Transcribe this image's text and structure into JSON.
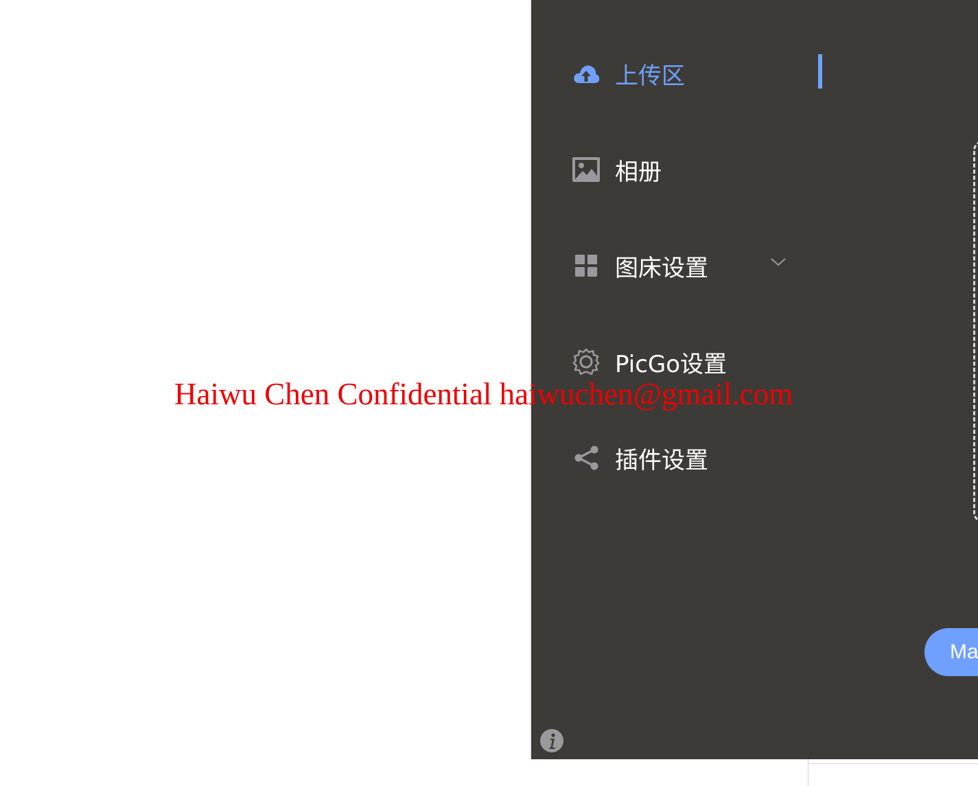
{
  "sidebar": {
    "items": [
      {
        "label": "上传区",
        "icon": "cloud-upload-icon",
        "active": true
      },
      {
        "label": "相册",
        "icon": "image-icon",
        "active": false
      },
      {
        "label": "图床设置",
        "icon": "grid-icon",
        "active": false,
        "expandable": true
      },
      {
        "label": "PicGo设置",
        "icon": "gear-icon",
        "active": false
      },
      {
        "label": "插件设置",
        "icon": "share-icon",
        "active": false
      }
    ]
  },
  "main": {
    "button_label": "Ma"
  },
  "footer": {
    "info_icon": "info-icon"
  },
  "watermark": {
    "text": "Haiwu Chen Confidential haiwuchen@gmail.com"
  },
  "colors": {
    "sidebar_bg": "#3d3b37",
    "accent": "#6fa0ff",
    "icon_gray": "#9a9a9e",
    "watermark": "#ee0000"
  }
}
